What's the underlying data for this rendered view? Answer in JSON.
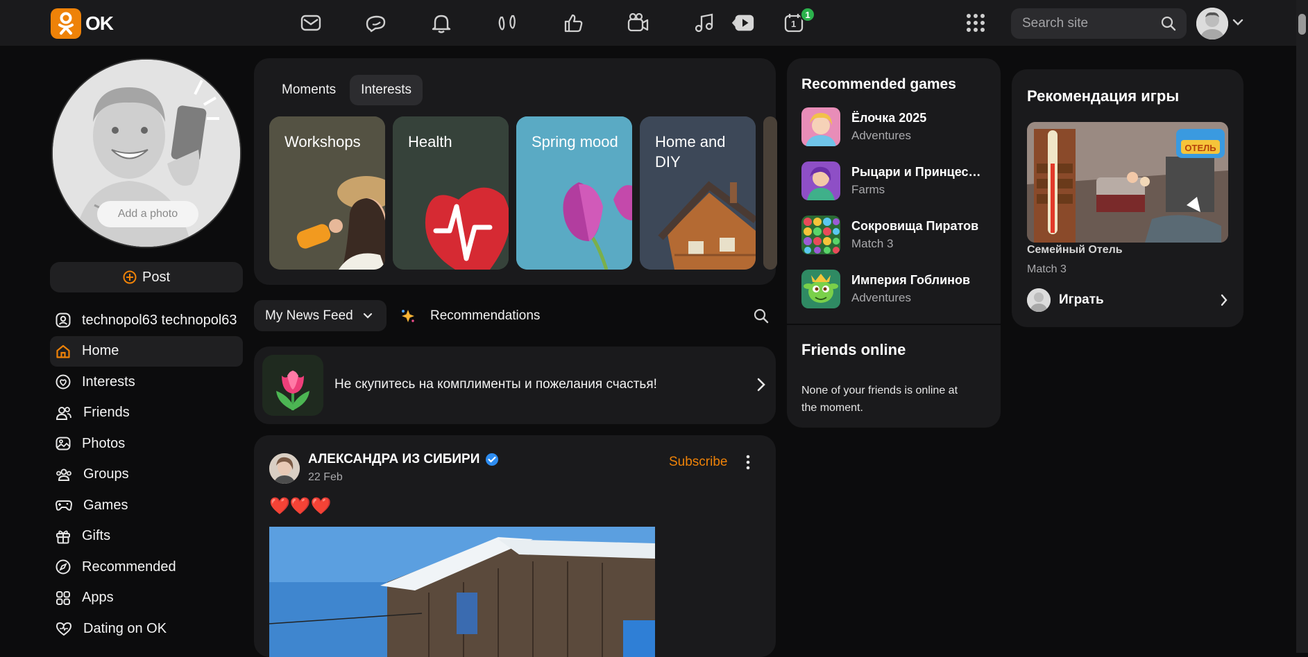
{
  "app": {
    "logo_text": "OK"
  },
  "topbar": {
    "search_placeholder": "Search site",
    "calendar_badge": "1",
    "calendar_date": "1"
  },
  "profile": {
    "add_photo": "Add a photo",
    "post_label": "Post"
  },
  "sidebar": {
    "items": [
      {
        "label": "technopol63 technopol63",
        "icon": "user-icon"
      },
      {
        "label": "Home",
        "icon": "home-icon"
      },
      {
        "label": "Interests",
        "icon": "interests-icon"
      },
      {
        "label": "Friends",
        "icon": "friends-icon"
      },
      {
        "label": "Photos",
        "icon": "photos-icon"
      },
      {
        "label": "Groups",
        "icon": "groups-icon"
      },
      {
        "label": "Games",
        "icon": "gamepad-icon"
      },
      {
        "label": "Gifts",
        "icon": "gift-icon"
      },
      {
        "label": "Recommended",
        "icon": "compass-icon"
      },
      {
        "label": "Apps",
        "icon": "apps-icon"
      },
      {
        "label": "Dating on OK",
        "icon": "dating-icon"
      }
    ]
  },
  "interests": {
    "tabs": [
      "Moments",
      "Interests"
    ],
    "tiles": [
      "Workshops",
      "Health",
      "Spring mood",
      "Home and DIY"
    ]
  },
  "feed": {
    "selector": "My News Feed",
    "recommendations": "Recommendations",
    "compliment_text": "Не скупитесь на комплименты и пожелания счастья!"
  },
  "post": {
    "author": "АЛЕКСАНДРА ИЗ СИБИРИ",
    "date": "22 Feb",
    "subscribe": "Subscribe",
    "text": "❤️❤️❤️"
  },
  "games_widget": {
    "title": "Recommended games",
    "games": [
      {
        "name": "Ёлочка 2025",
        "genre": "Adventures"
      },
      {
        "name": "Рыцари и Принцессы",
        "genre": "Farms"
      },
      {
        "name": "Сокровища Пиратов",
        "genre": "Match 3"
      },
      {
        "name": "Империя Гоблинов",
        "genre": "Adventures"
      }
    ]
  },
  "friends_online": {
    "title": "Friends online",
    "message": "None of your friends is online at the moment."
  },
  "game_reco": {
    "title": "Рекомендация игры",
    "game_name": "Семейный Отель",
    "genre": "Match 3",
    "play": "Играть",
    "banner_text": "Семейный Отель"
  },
  "colors": {
    "accent": "#ee8208",
    "badge": "#2bb24c",
    "bg": "#0c0c0d",
    "card": "#1a1a1c"
  }
}
